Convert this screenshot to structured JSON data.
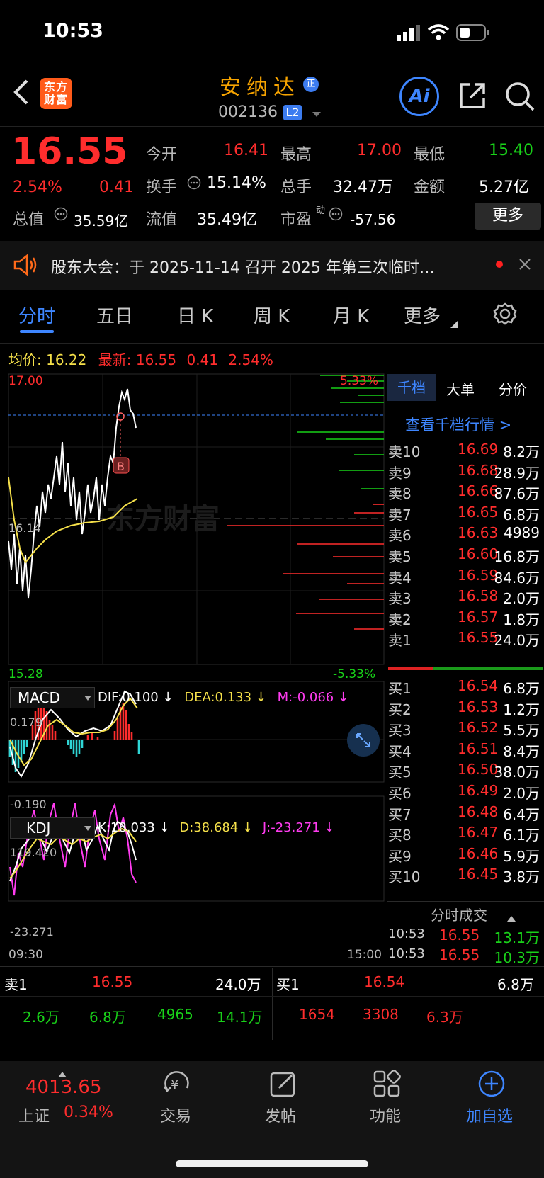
{
  "status": {
    "time": "10:53"
  },
  "header": {
    "logo": "东方财富",
    "name": "安纳达",
    "badge": "正",
    "code": "002136",
    "level": "L2"
  },
  "quote": {
    "price": "16.55",
    "pct": "2.54%",
    "chg": "0.41",
    "r1": [
      "今开",
      "16.41",
      "最高",
      "17.00",
      "最低",
      "15.40"
    ],
    "r2": [
      "换手",
      "15.14%",
      "总手",
      "32.47万",
      "金额",
      "5.27亿"
    ],
    "r3": [
      "总值",
      "35.59亿",
      "流值",
      "35.49亿",
      "市盈",
      "-57.56"
    ],
    "pe_sup": "动",
    "more": "更多"
  },
  "notice": {
    "text": "股东大会：于 2025-11-14 召开 2025 年第三次临时…"
  },
  "tabs": [
    "分时",
    "五日",
    "日 K",
    "周 K",
    "月 K",
    "更多"
  ],
  "chart": {
    "avg_label": "均价:",
    "avg": "16.22",
    "last_label": "最新:",
    "last": "16.55",
    "chg": "0.41",
    "pct": "2.54%",
    "top": "17.00",
    "mid": "16.14",
    "bot": "15.28",
    "top_pct": "5.33%",
    "bot_pct": "-5.33%",
    "t_start": "09:30",
    "t_end": "15:00",
    "watermark": "东方财富",
    "b_marker": "B"
  },
  "macd": {
    "name": "MACD",
    "dif": "DIF:0.100 ↓",
    "dea": "DEA:0.133 ↓",
    "m": "M:-0.066 ↓",
    "max": "0.179",
    "min": "-0.190"
  },
  "kdj": {
    "name": "KDJ",
    "k": "K:18.033 ↓",
    "d": "D:38.684 ↓",
    "j": "J:-23.271 ↓",
    "max": "119.420",
    "min": "-23.271"
  },
  "book": {
    "tabs": [
      "千档",
      "大单",
      "分价"
    ],
    "link": "查看千档行情 >",
    "asks": [
      [
        "卖10",
        "16.69",
        "8.2万"
      ],
      [
        "卖9",
        "16.68",
        "28.9万"
      ],
      [
        "卖8",
        "16.66",
        "87.6万"
      ],
      [
        "卖7",
        "16.65",
        "6.8万"
      ],
      [
        "卖6",
        "16.63",
        "4989"
      ],
      [
        "卖5",
        "16.60",
        "16.8万"
      ],
      [
        "卖4",
        "16.59",
        "84.6万"
      ],
      [
        "卖3",
        "16.58",
        "2.0万"
      ],
      [
        "卖2",
        "16.57",
        "1.8万"
      ],
      [
        "卖1",
        "16.55",
        "24.0万"
      ]
    ],
    "bids": [
      [
        "买1",
        "16.54",
        "6.8万"
      ],
      [
        "买2",
        "16.53",
        "1.2万"
      ],
      [
        "买3",
        "16.52",
        "5.5万"
      ],
      [
        "买4",
        "16.51",
        "8.4万"
      ],
      [
        "买5",
        "16.50",
        "38.0万"
      ],
      [
        "买6",
        "16.49",
        "2.0万"
      ],
      [
        "买7",
        "16.48",
        "6.4万"
      ],
      [
        "买8",
        "16.47",
        "6.1万"
      ],
      [
        "买9",
        "16.46",
        "5.9万"
      ],
      [
        "买10",
        "16.45",
        "3.8万"
      ]
    ],
    "trades_title": "分时成交",
    "trades": [
      [
        "10:53",
        "16.55",
        "13.1万"
      ],
      [
        "10:53",
        "16.55",
        "10.3万"
      ]
    ]
  },
  "bottom_bar": {
    "s1_label": "卖1",
    "s1_price": "16.55",
    "s1_vol": "24.0万",
    "b1_label": "买1",
    "b1_price": "16.54",
    "b1_vol": "6.8万",
    "s_queue": [
      "2.6万",
      "6.8万",
      "4965",
      "14.1万"
    ],
    "b_queue": [
      "1654",
      "3308",
      "6.3万"
    ]
  },
  "nav": {
    "index_value": "4013.65",
    "index_name": "上证",
    "index_pct": "0.34%",
    "items": [
      "交易",
      "发帖",
      "功能",
      "加自选"
    ]
  }
}
